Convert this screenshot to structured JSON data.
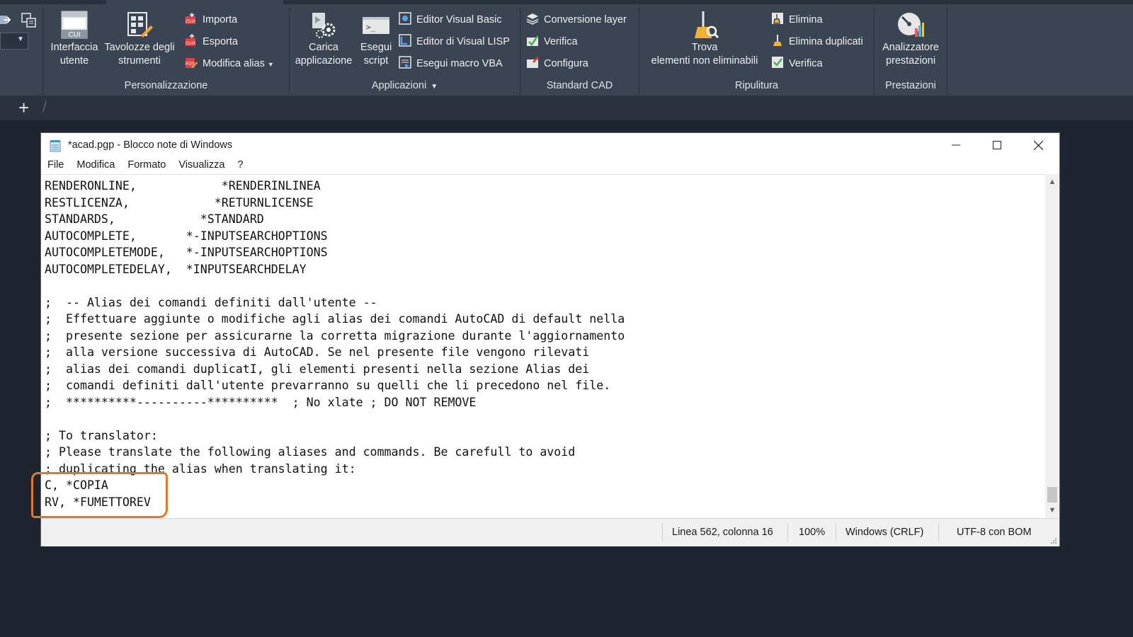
{
  "ribbon": {
    "personalizzazione": {
      "title": "Personalizzazione",
      "interfaccia": {
        "line1": "Interfaccia",
        "line2": "utente",
        "icon_text": "CUI"
      },
      "tavolozze": {
        "line1": "Tavolozze degli",
        "line2": "strumenti"
      },
      "importa": "Importa",
      "esporta": "Esporta",
      "modifica_alias": "Modifica alias"
    },
    "applicazioni": {
      "title": "Applicazioni",
      "carica": {
        "line1": "Carica",
        "line2": "applicazione"
      },
      "esegui": {
        "line1": "Esegui",
        "line2": "script"
      },
      "editor_vb": "Editor Visual Basic",
      "editor_lisp": "Editor di Visual LISP",
      "esegui_vba": "Esegui macro VBA"
    },
    "standard_cad": {
      "title": "Standard CAD",
      "conversione": "Conversione layer",
      "verifica": "Verifica",
      "configura": "Configura"
    },
    "ripulitura": {
      "title": "Ripulitura",
      "trova": {
        "line1": "Trova",
        "line2": "elementi non eliminabili"
      },
      "elimina": "Elimina",
      "elimina_duplicati": "Elimina duplicati",
      "verifica": "Verifica"
    },
    "prestazioni": {
      "title": "Prestazioni",
      "analizzatore": {
        "line1": "Analizzatore",
        "line2": "prestazioni"
      }
    }
  },
  "tabbar": {
    "add_label": "+"
  },
  "notepad": {
    "title": "*acad.pgp - Blocco note di Windows",
    "menus": [
      "File",
      "Modifica",
      "Formato",
      "Visualizza",
      "?"
    ],
    "content": "RENDERONLINE,            *RENDERINLINEA\nRESTLICENZA,            *RETURNLICENSE\nSTANDARDS,            *STANDARD\nAUTOCOMPLETE,       *-INPUTSEARCHOPTIONS\nAUTOCOMPLETEMODE,   *-INPUTSEARCHOPTIONS\nAUTOCOMPLETEDELAY,  *INPUTSEARCHDELAY\n\n;  -- Alias dei comandi definiti dall'utente --\n;  Effettuare aggiunte o modifiche agli alias dei comandi AutoCAD di default nella\n;  presente sezione per assicurarne la corretta migrazione durante l'aggiornamento\n;  alla versione successiva di AutoCAD. Se nel presente file vengono rilevati\n;  alias dei comandi duplicatI, gli elementi presenti nella sezione Alias dei\n;  comandi definiti dall'utente prevarranno su quelli che li precedono nel file.\n;  **********----------**********  ; No xlate ; DO NOT REMOVE\n\n; To translator:\n; Please translate the following aliases and commands. Be carefull to avoid\n; duplicating the alias when translating it:\nC, *COPIA\nRV, *FUMETTOREV",
    "status": {
      "position": "Linea 562, colonna 16",
      "zoom": "100%",
      "line_ending": "Windows (CRLF)",
      "encoding": "UTF-8 con BOM"
    }
  },
  "colors": {
    "ribbon_bg": "#3b4453",
    "desktop_bg": "#1f2530",
    "highlight": "#e87722"
  }
}
